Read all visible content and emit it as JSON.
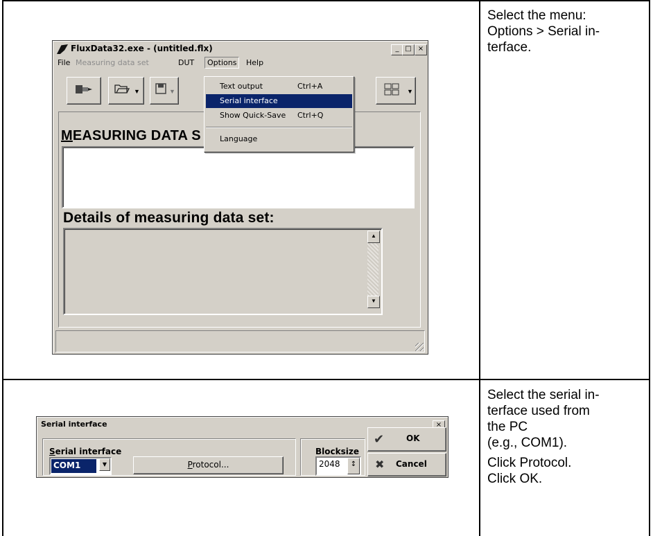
{
  "instructions": {
    "step1": [
      "Select the menu:",
      "Options > Serial in-",
      "terface."
    ],
    "step2_a": [
      "Select the serial in-",
      "terface used from",
      "the PC",
      "(e.g., COM1)."
    ],
    "step2_b": [
      "Click Protocol.",
      "Click OK."
    ]
  },
  "main_window": {
    "title": "FluxData32.exe - (untitled.flx)",
    "caption_buttons": [
      "_",
      "□",
      "×"
    ],
    "menu": [
      "File",
      "Measuring data set",
      "DUT",
      "Options",
      "Help"
    ],
    "heading_rest": "EASURING DATA S",
    "heading_mnemonic": "M",
    "details_heading": "Details of measuring data set:",
    "options_menu": {
      "items": [
        {
          "label": "Text output",
          "accel": "Ctrl+A"
        },
        {
          "label": "Serial interface",
          "accel": ""
        },
        {
          "label": "Show Quick-Save",
          "accel": "Ctrl+Q"
        },
        {
          "label": "Language",
          "accel": ""
        }
      ],
      "selected": "Serial interface"
    }
  },
  "dialog": {
    "title": "Serial interface",
    "close": "×",
    "group_label_mnemonic": "S",
    "group_label_rest": "erial interface",
    "port_value": "COM1",
    "protocol_mnemonic": "P",
    "protocol_rest": "rotocol...",
    "blocksize_label": "Blocksize",
    "blocksize_value": "2048",
    "ok_label": "OK",
    "cancel_label": "Cancel"
  },
  "icons": [
    "connect-icon",
    "folder-open-icon",
    "save-icon",
    "layout-icon",
    "app-icon",
    "checkmark-icon",
    "cross-icon"
  ]
}
